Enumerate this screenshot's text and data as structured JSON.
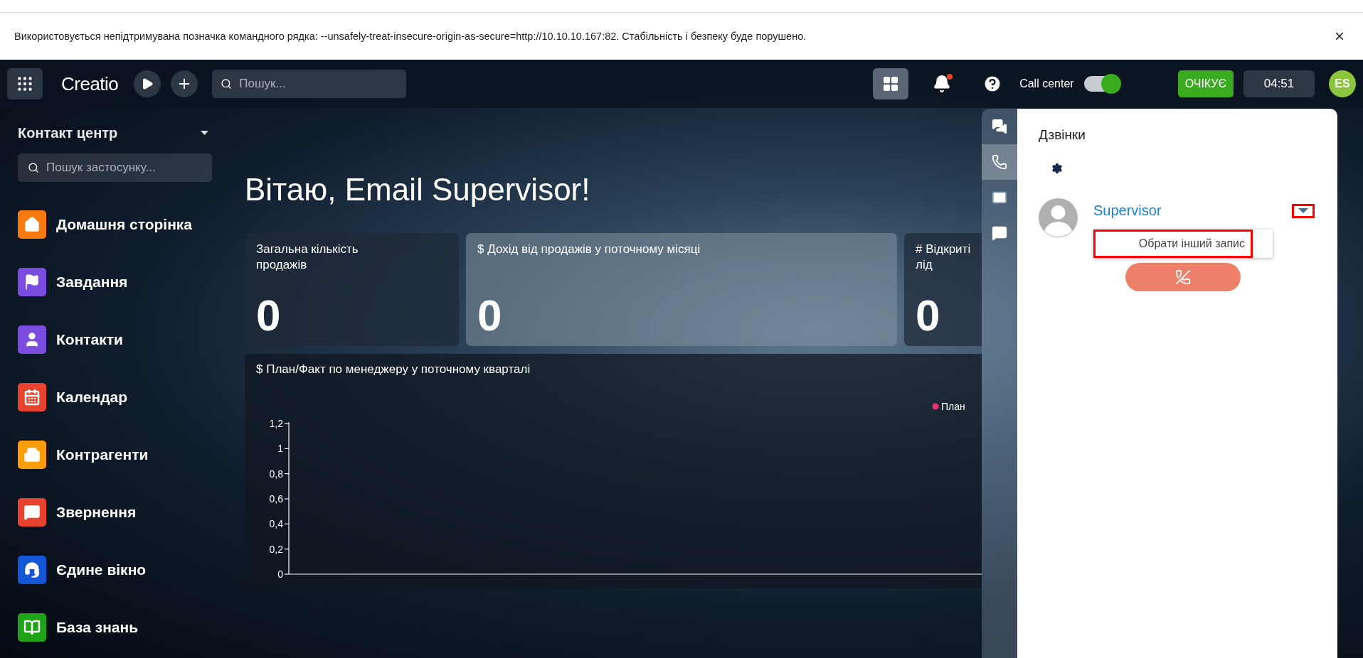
{
  "browser_notice": {
    "text": "Використовується непідтримувана позначка командного рядка: --unsafely-treat-insecure-origin-as-secure=http://10.10.10.167:82. Стабільність і безпеку буде порушено.",
    "close": "×"
  },
  "header": {
    "logo": "Creatio",
    "search": {
      "placeholder": "Пошук..."
    },
    "notifications": {
      "unread": true
    },
    "call_center": {
      "label": "Call center",
      "on": true
    },
    "status": "ОЧІКУЄ",
    "timer": "04:51",
    "user_initials": "ES"
  },
  "sidebar": {
    "workspace": "Контакт центр",
    "search": {
      "placeholder": "Пошук застосунку..."
    },
    "items": [
      {
        "label": "Домашня сторінка",
        "kind": "home",
        "color": "#fb7a10"
      },
      {
        "label": "Завдання",
        "kind": "tasks",
        "color": "#7b4ce0"
      },
      {
        "label": "Контакти",
        "kind": "contacts",
        "color": "#7b4ce0"
      },
      {
        "label": "Календар",
        "kind": "calendar",
        "color": "#e8432e"
      },
      {
        "label": "Контрагенти",
        "kind": "accounts",
        "color": "#ff9c0a"
      },
      {
        "label": "Звернення",
        "kind": "cases",
        "color": "#e8432e"
      },
      {
        "label": "Єдине вікно",
        "kind": "agent",
        "color": "#1457d8"
      },
      {
        "label": "База знань",
        "kind": "knowledge",
        "color": "#1fa317"
      }
    ]
  },
  "greeting": "Вітаю, Email Supervisor!",
  "metrics": [
    {
      "title": "Загальна кількість продажів",
      "value": "0"
    },
    {
      "title": "$ Дохід від продажів у поточному місяці",
      "value": "0"
    },
    {
      "title": "# Відкриті лід",
      "value": "0"
    }
  ],
  "chart": {
    "chart_data": {
      "type": "bar",
      "title": "$ План/Факт по менеджеру у поточному кварталі",
      "ylim": [
        0,
        1.2
      ],
      "yticks": [
        {
          "value": 0,
          "label": "0"
        },
        {
          "value": 0.2,
          "label": "0,2"
        },
        {
          "value": 0.4,
          "label": "0,4"
        },
        {
          "value": 0.6,
          "label": "0,6"
        },
        {
          "value": 0.8,
          "label": "0,8"
        },
        {
          "value": 1,
          "label": "1"
        },
        {
          "value": 1.2,
          "label": "1,2"
        }
      ],
      "series": [
        {
          "name": "План",
          "color": "#e8336d"
        }
      ]
    }
  },
  "communication_panel": {
    "tabs": [
      {
        "kind": "chat",
        "selected": false
      },
      {
        "kind": "phone",
        "selected": true
      },
      {
        "kind": "email",
        "selected": false
      },
      {
        "kind": "message",
        "selected": false
      }
    ],
    "title": "Дзвінки",
    "call": {
      "contact": "Supervisor",
      "caret_highlighted": true,
      "menu": {
        "open": true,
        "items": [
          {
            "label": "Обрати інший запис",
            "highlighted": true
          }
        ]
      }
    }
  }
}
